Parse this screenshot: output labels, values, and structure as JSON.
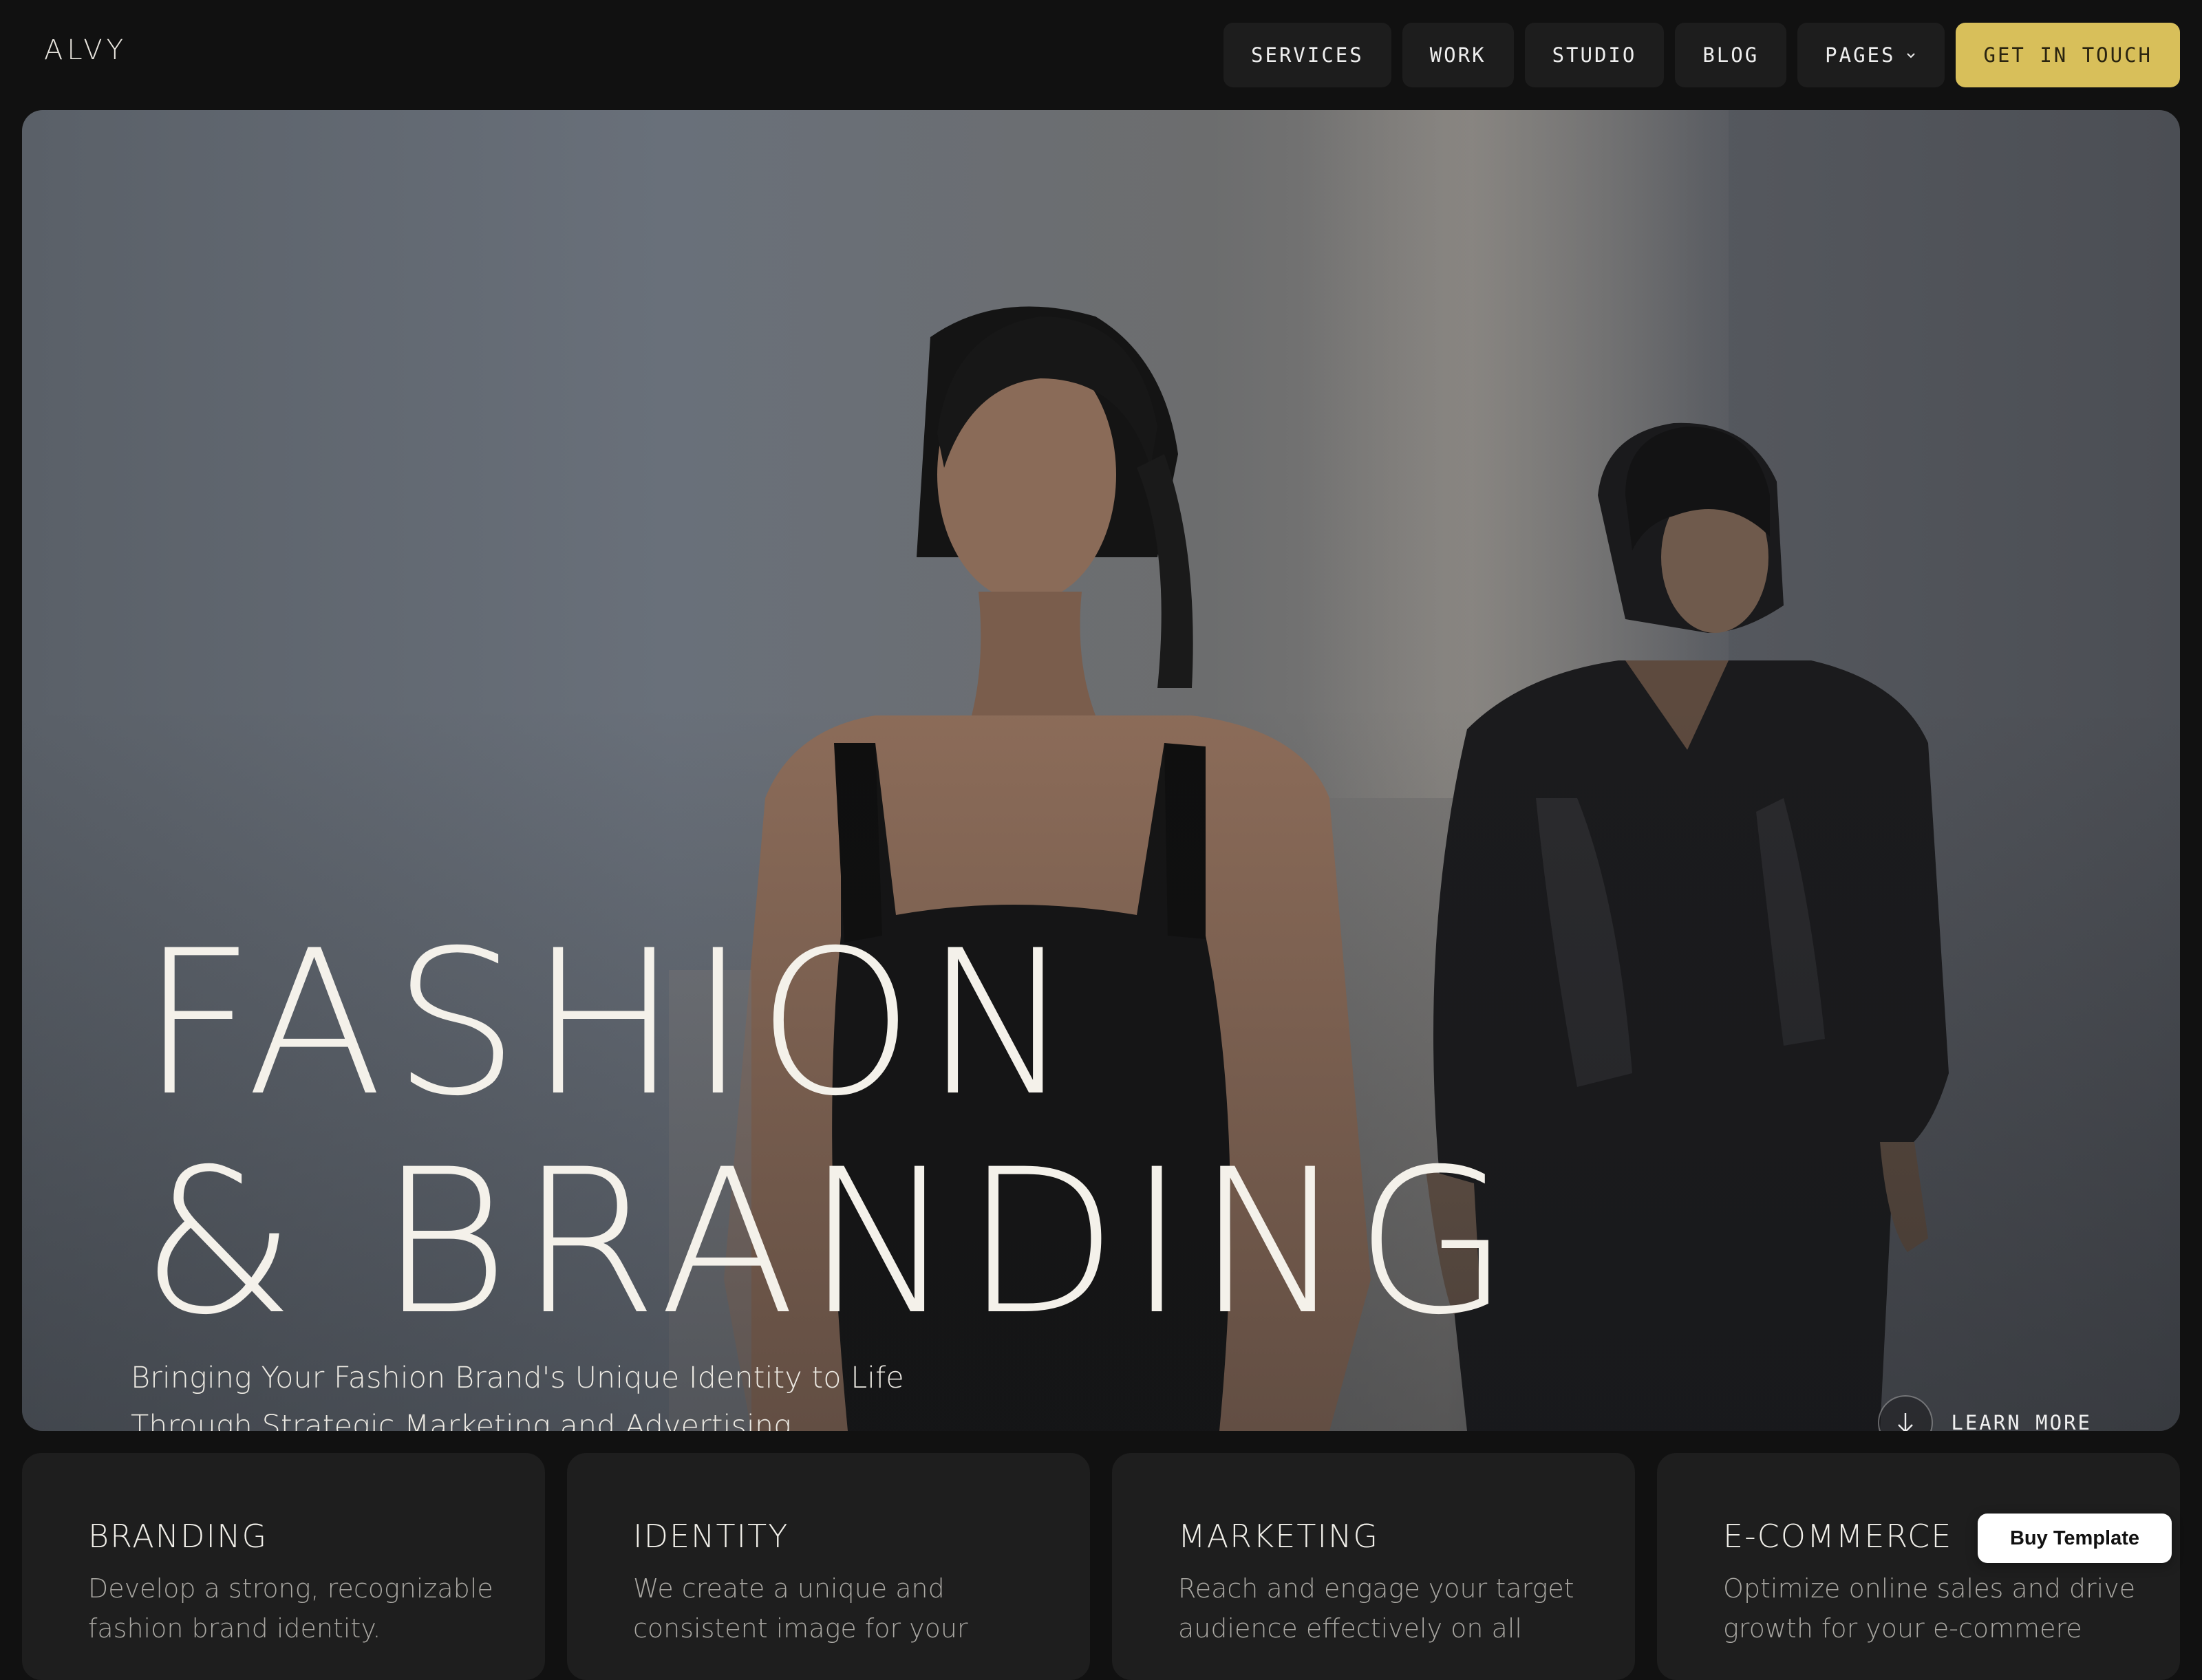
{
  "brand": {
    "logo": "ALVY"
  },
  "nav": {
    "items": [
      "SERVICES",
      "WORK",
      "STUDIO",
      "BLOG"
    ],
    "pages_label": "PAGES",
    "cta_label": "GET IN TOUCH"
  },
  "hero": {
    "title_line1": "FASHION",
    "title_line2": "& BRANDING",
    "subtitle_line1": "Bringing Your Fashion Brand's Unique Identity to Life",
    "subtitle_line2": "Through Strategic Marketing and Advertising.",
    "learn_more": "LEARN MORE",
    "learn_icon": "arrow-down-icon"
  },
  "services": [
    {
      "title": "BRANDING",
      "text": "Develop a strong, recognizable fashion brand identity."
    },
    {
      "title": "IDENTITY",
      "text": "We create a unique and consistent image for your"
    },
    {
      "title": "MARKETING",
      "text": "Reach and engage your target audience effectively on all"
    },
    {
      "title": "E-COMMERCE",
      "text": "Optimize online sales and drive growth for your e-commere"
    }
  ],
  "floating": {
    "buy_label": "Buy Template"
  },
  "colors": {
    "background": "#111111",
    "accent": "#d8bf5a",
    "card": "#1e1e1e"
  }
}
